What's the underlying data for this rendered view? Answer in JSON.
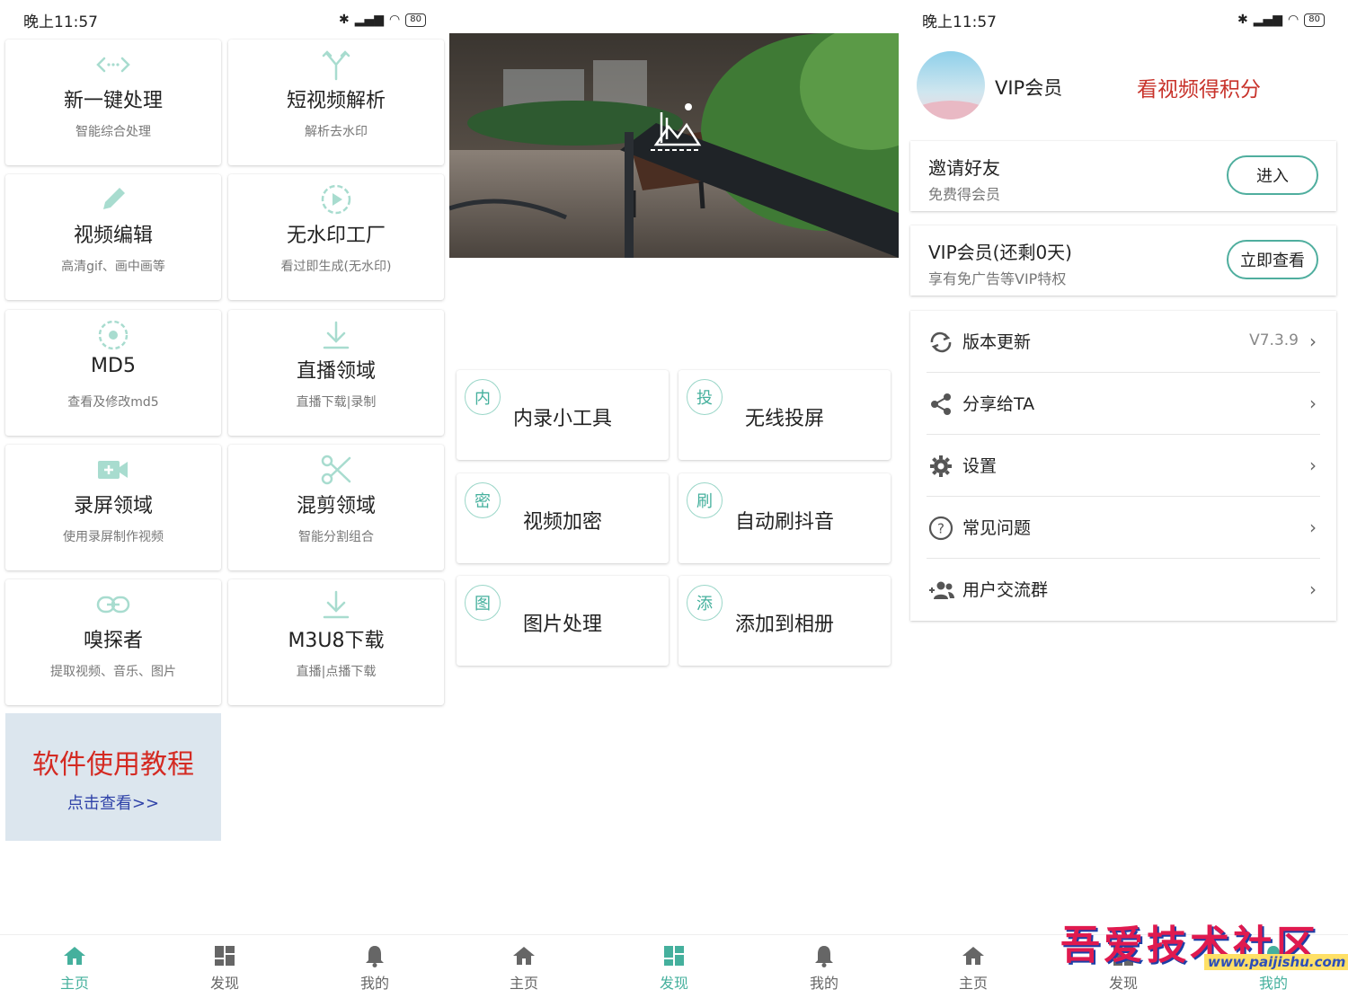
{
  "status_bar": {
    "time": "晚上11:57",
    "battery": "80"
  },
  "home": {
    "tiles": [
      {
        "title": "新一键处理",
        "sub": "智能综合处理",
        "icon": "code-arrows-icon"
      },
      {
        "title": "短视频解析",
        "sub": "解析去水印",
        "icon": "merge-arrows-icon"
      },
      {
        "title": "视频编辑",
        "sub": "高清gif、画中画等",
        "icon": "pencil-icon"
      },
      {
        "title": "无水印工厂",
        "sub": "看过即生成(无水印)",
        "icon": "play-circle-icon"
      },
      {
        "title": "MD5",
        "sub": "查看及修改md5",
        "icon": "target-icon"
      },
      {
        "title": "直播领域",
        "sub": "直播下载|录制",
        "icon": "download-icon"
      },
      {
        "title": "录屏领域",
        "sub": "使用录屏制作视频",
        "icon": "video-add-icon"
      },
      {
        "title": "混剪领域",
        "sub": "智能分割组合",
        "icon": "scissors-icon"
      },
      {
        "title": "嗅探者",
        "sub": "提取视频、音乐、图片",
        "icon": "link-icon"
      },
      {
        "title": "M3U8下载",
        "sub": "直播|点播下载",
        "icon": "download-icon"
      }
    ],
    "tutorial": {
      "title": "软件使用教程",
      "link": "点击查看>>"
    }
  },
  "discover": {
    "tools": [
      {
        "badge": "内",
        "title": "内录小工具"
      },
      {
        "badge": "投",
        "title": "无线投屏"
      },
      {
        "badge": "密",
        "title": "视频加密"
      },
      {
        "badge": "刷",
        "title": "自动刷抖音"
      },
      {
        "badge": "图",
        "title": "图片处理"
      },
      {
        "badge": "添",
        "title": "添加到相册"
      }
    ]
  },
  "mine": {
    "vip_label": "VIP会员",
    "points_label": "看视频得积分",
    "invite": {
      "title": "邀请好友",
      "sub": "免费得会员",
      "button": "进入"
    },
    "vip_card": {
      "title": "VIP会员(还剩0天)",
      "sub": "享有免广告等VIP特权",
      "button": "立即查看"
    },
    "menu": [
      {
        "label": "版本更新",
        "value": "V7.3.9",
        "icon": "refresh-icon"
      },
      {
        "label": "分享给TA",
        "value": "",
        "icon": "share-icon"
      },
      {
        "label": "设置",
        "value": "",
        "icon": "gear-icon"
      },
      {
        "label": "常见问题",
        "value": "",
        "icon": "question-icon"
      },
      {
        "label": "用户交流群",
        "value": "",
        "icon": "group-add-icon"
      }
    ]
  },
  "nav": {
    "home": "主页",
    "discover": "发现",
    "mine": "我的"
  },
  "watermark": {
    "text": "吾爱技术社区",
    "url": "www.paijishu.com"
  },
  "colors": {
    "accent": "#45b09d",
    "icon_light": "#a8dccf",
    "tutorial_bg": "#dce6ee",
    "tutorial_title": "#d42a22",
    "points": "#c8332b"
  }
}
